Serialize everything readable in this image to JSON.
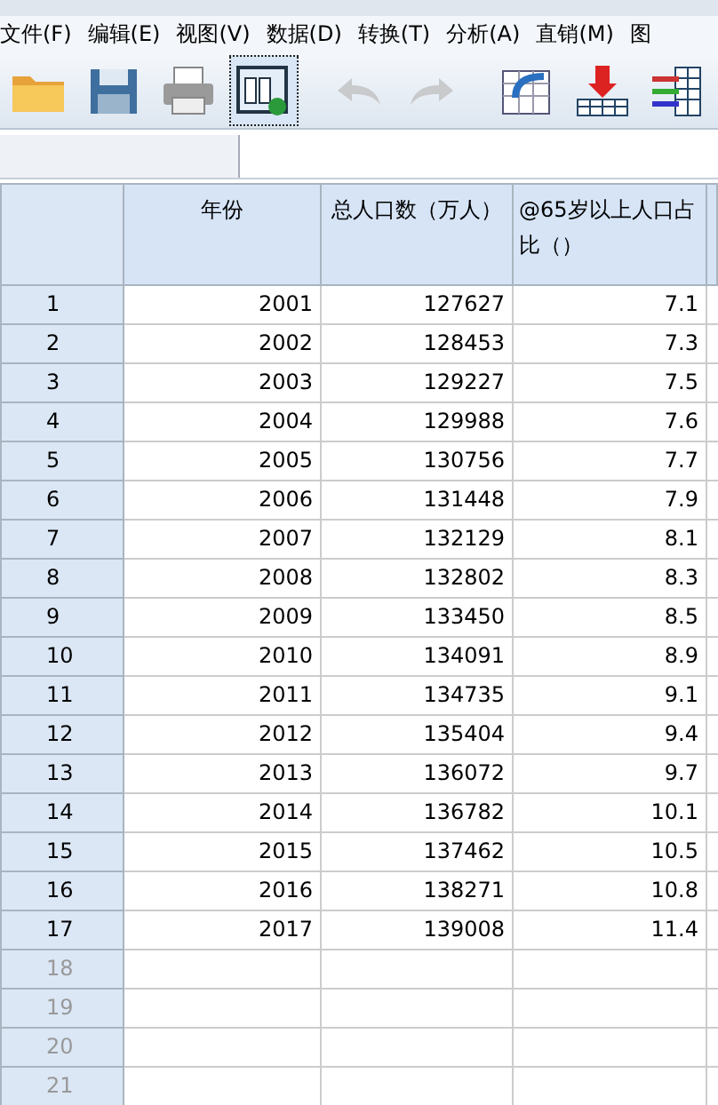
{
  "menu": [
    "文件(F)",
    "编辑(E)",
    "视图(V)",
    "数据(D)",
    "转换(T)",
    "分析(A)",
    "直销(M)",
    "图"
  ],
  "toolbar": [
    {
      "kind": "folder",
      "disabled": false,
      "selected": false
    },
    {
      "kind": "disk",
      "disabled": false,
      "selected": false
    },
    {
      "kind": "printer",
      "disabled": false,
      "selected": false
    },
    {
      "kind": "dialog",
      "disabled": false,
      "selected": true
    },
    {
      "kind": "undo",
      "disabled": true,
      "selected": false
    },
    {
      "kind": "redo",
      "disabled": true,
      "selected": false
    },
    {
      "kind": "goto",
      "disabled": false,
      "selected": false
    },
    {
      "kind": "insert",
      "disabled": false,
      "selected": false
    },
    {
      "kind": "columns",
      "disabled": false,
      "selected": false
    }
  ],
  "table": {
    "columns": [
      "年份",
      "总人口数（万人）",
      "@65岁以上人口占比（）"
    ],
    "rows": [
      {
        "label": "1",
        "values": [
          "2001",
          "127627",
          "7.1"
        ]
      },
      {
        "label": "2",
        "values": [
          "2002",
          "128453",
          "7.3"
        ]
      },
      {
        "label": "3",
        "values": [
          "2003",
          "129227",
          "7.5"
        ]
      },
      {
        "label": "4",
        "values": [
          "2004",
          "129988",
          "7.6"
        ]
      },
      {
        "label": "5",
        "values": [
          "2005",
          "130756",
          "7.7"
        ]
      },
      {
        "label": "6",
        "values": [
          "2006",
          "131448",
          "7.9"
        ]
      },
      {
        "label": "7",
        "values": [
          "2007",
          "132129",
          "8.1"
        ]
      },
      {
        "label": "8",
        "values": [
          "2008",
          "132802",
          "8.3"
        ]
      },
      {
        "label": "9",
        "values": [
          "2009",
          "133450",
          "8.5"
        ]
      },
      {
        "label": "10",
        "values": [
          "2010",
          "134091",
          "8.9"
        ]
      },
      {
        "label": "11",
        "values": [
          "2011",
          "134735",
          "9.1"
        ]
      },
      {
        "label": "12",
        "values": [
          "2012",
          "135404",
          "9.4"
        ]
      },
      {
        "label": "13",
        "values": [
          "2013",
          "136072",
          "9.7"
        ]
      },
      {
        "label": "14",
        "values": [
          "2014",
          "136782",
          "10.1"
        ]
      },
      {
        "label": "15",
        "values": [
          "2015",
          "137462",
          "10.5"
        ]
      },
      {
        "label": "16",
        "values": [
          "2016",
          "138271",
          "10.8"
        ]
      },
      {
        "label": "17",
        "values": [
          "2017",
          "139008",
          "11.4"
        ]
      },
      {
        "label": "18"
      },
      {
        "label": "19"
      },
      {
        "label": "20"
      },
      {
        "label": "21"
      }
    ]
  }
}
